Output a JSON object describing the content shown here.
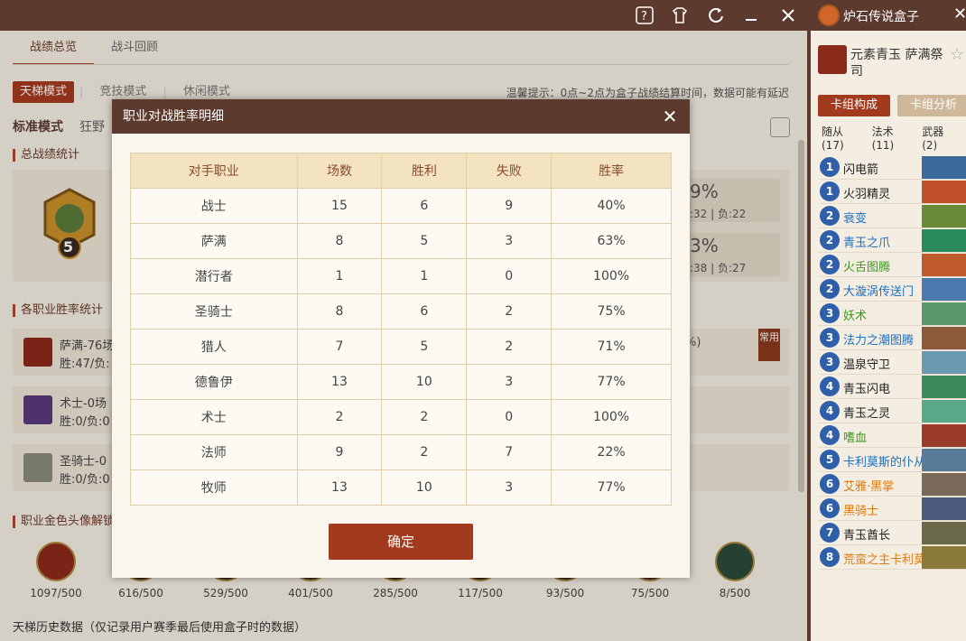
{
  "topbar": {
    "help_icon": "help-icon",
    "shirt_icon": "shirt-icon",
    "refresh_icon": "refresh-icon"
  },
  "tabs": [
    {
      "label": "战绩总览"
    },
    {
      "label": "战斗回顾"
    }
  ],
  "modes": [
    {
      "label": "天梯模式"
    },
    {
      "label": "竞技模式"
    },
    {
      "label": "休闲模式"
    }
  ],
  "tip": "温馨提示：0点~2点为盒子战绩结算时间，数据可能有延迟",
  "subtabs": [
    {
      "label": "标准模式"
    },
    {
      "label": "狂野"
    }
  ],
  "sections": {
    "overall": "总战绩统计",
    "by_class": "各职业胜率统计",
    "golden": "职业金色头像解锁"
  },
  "rank_badge": "5",
  "stats": [
    {
      "pct": "9%",
      "detail": ":32 | 负:22"
    },
    {
      "pct": "3%",
      "detail": ":38 | 负:27"
    }
  ],
  "class_rows": [
    {
      "name": "萨满-76场",
      "record": "胜:47/负:",
      "pct": "%)"
    },
    {
      "name": "术士-0场",
      "record": "胜:0/负:0"
    },
    {
      "name": "圣骑士-0",
      "record": "胜:0/负:0"
    }
  ],
  "common_tag": "常用",
  "golden": [
    "1097/500",
    "616/500",
    "529/500",
    "401/500",
    "285/500",
    "117/500",
    "93/500",
    "75/500",
    "8/500"
  ],
  "bottom_text": "天梯历史数据（仅记录用户赛季最后使用盒子时的数据）",
  "modal": {
    "title": "职业对战胜率明细",
    "headers": [
      "对手职业",
      "场数",
      "胜利",
      "失败",
      "胜率"
    ],
    "rows": [
      [
        "战士",
        "15",
        "6",
        "9",
        "40%"
      ],
      [
        "萨满",
        "8",
        "5",
        "3",
        "63%"
      ],
      [
        "潜行者",
        "1",
        "1",
        "0",
        "100%"
      ],
      [
        "圣骑士",
        "8",
        "6",
        "2",
        "75%"
      ],
      [
        "猎人",
        "7",
        "5",
        "2",
        "71%"
      ],
      [
        "德鲁伊",
        "13",
        "10",
        "3",
        "77%"
      ],
      [
        "术士",
        "2",
        "2",
        "0",
        "100%"
      ],
      [
        "法师",
        "9",
        "2",
        "7",
        "22%"
      ],
      [
        "牧师",
        "13",
        "10",
        "3",
        "77%"
      ]
    ],
    "ok": "确定"
  },
  "side": {
    "title": "炉石传说盒子",
    "deck_name": "元素青玉 萨满祭司",
    "tab_build": "卡组构成",
    "tab_analysis": "卡组分析",
    "counts": [
      "随从(17)",
      "法术(11)",
      "武器(2)"
    ],
    "cards": [
      {
        "cost": "1",
        "name": "闪电箭",
        "color": "#222"
      },
      {
        "cost": "1",
        "name": "火羽精灵",
        "color": "#222"
      },
      {
        "cost": "2",
        "name": "衰变",
        "color": "#1c6fc2"
      },
      {
        "cost": "2",
        "name": "青玉之爪",
        "color": "#1c6fc2"
      },
      {
        "cost": "2",
        "name": "火舌图腾",
        "color": "#3a9a1a"
      },
      {
        "cost": "2",
        "name": "大漩涡传送门",
        "color": "#1c6fc2"
      },
      {
        "cost": "3",
        "name": "妖术",
        "color": "#3a9a1a"
      },
      {
        "cost": "3",
        "name": "法力之潮图腾",
        "color": "#1c6fc2"
      },
      {
        "cost": "3",
        "name": "温泉守卫",
        "color": "#222"
      },
      {
        "cost": "4",
        "name": "青玉闪电",
        "color": "#222"
      },
      {
        "cost": "4",
        "name": "青玉之灵",
        "color": "#222"
      },
      {
        "cost": "4",
        "name": "嗜血",
        "color": "#3a9a1a"
      },
      {
        "cost": "5",
        "name": "卡利莫斯的仆从",
        "color": "#1c6fc2"
      },
      {
        "cost": "6",
        "name": "艾雅·黑掌",
        "color": "#e07a10"
      },
      {
        "cost": "6",
        "name": "黑骑士",
        "color": "#e07a10"
      },
      {
        "cost": "7",
        "name": "青玉酋长",
        "color": "#222"
      },
      {
        "cost": "8",
        "name": "荒蛮之主卡利莫斯",
        "color": "#e07a10"
      }
    ]
  }
}
